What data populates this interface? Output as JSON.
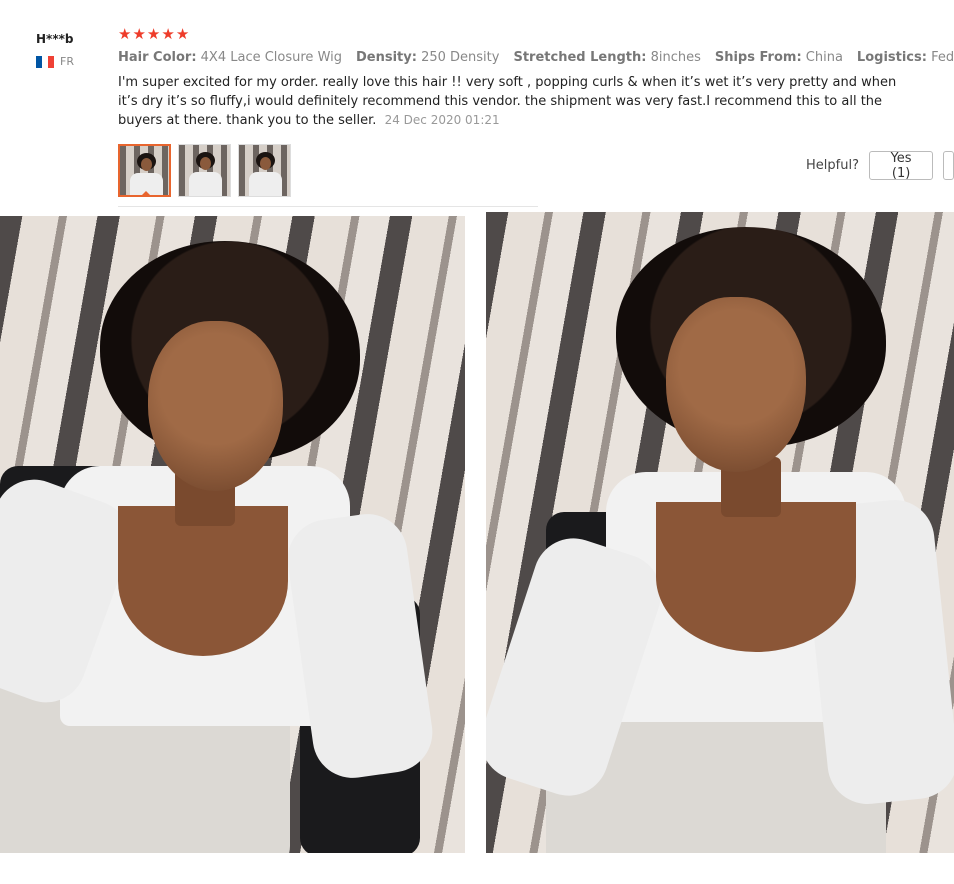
{
  "reviewer": {
    "name": "H***b",
    "country": "FR",
    "flag_colors": [
      "#0055a4",
      "#ffffff",
      "#ef4135"
    ]
  },
  "review": {
    "stars": [
      "★",
      "★",
      "★",
      "★",
      "★"
    ],
    "rating": 5,
    "star_color": "#ee3c2a",
    "attributes": [
      {
        "key": "Hair Color:",
        "value": "4X4 Lace Closure Wig"
      },
      {
        "key": "Density:",
        "value": "250 Density"
      },
      {
        "key": "Stretched Length:",
        "value": "8inches"
      },
      {
        "key": "Ships From:",
        "value": "China"
      },
      {
        "key": "Logistics:",
        "value": "Fedex IP"
      }
    ],
    "text": "I'm super excited for my order. really love this hair !! very soft , popping curls & when it’s wet it’s very pretty and when it’s dry it’s so fluffy,i would definitely recommend this vendor. the shipment was very fast.I recommend this to all the buyers at there. thank you to the seller.",
    "date": "24 Dec 2020 01:21"
  },
  "thumbnails": {
    "count": 3,
    "selected_index": 0,
    "accent_color": "#e8652e"
  },
  "helpful": {
    "label": "Helpful?",
    "yes_label": "Yes (1)"
  }
}
